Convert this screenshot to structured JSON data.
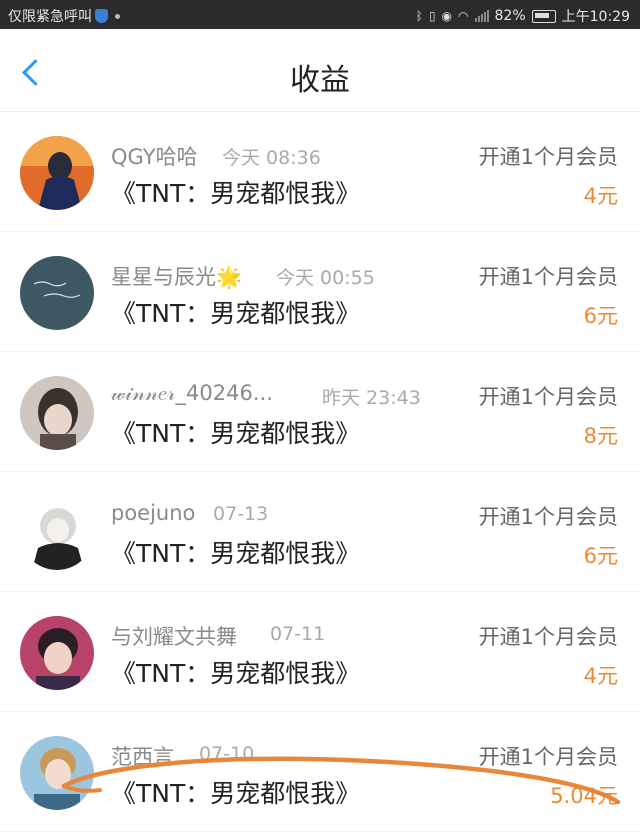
{
  "status_bar": {
    "carrier_text": "仅限紧急呼叫",
    "battery_percent": "82%",
    "time": "上午10:29"
  },
  "header": {
    "title": "收益",
    "back_icon": "chevron-left-icon",
    "accent_color": "#2b9bef"
  },
  "earnings": [
    {
      "name": "QGY哈哈",
      "time": "今天 08:36",
      "action": "开通1个月会员",
      "book": "《TNT：男宠都恨我》",
      "amount": "4元"
    },
    {
      "name": "星星与辰光🌟",
      "time": "今天 00:55",
      "action": "开通1个月会员",
      "book": "《TNT：男宠都恨我》",
      "amount": "6元"
    },
    {
      "name": "𝓌𝒾𝓃𝓃𝑒𝓇_40246...",
      "time": "昨天 23:43",
      "action": "开通1个月会员",
      "book": "《TNT：男宠都恨我》",
      "amount": "8元"
    },
    {
      "name": "poejuno",
      "time": "07-13",
      "action": "开通1个月会员",
      "book": "《TNT：男宠都恨我》",
      "amount": "6元"
    },
    {
      "name": "与刘耀文共舞",
      "time": "07-11",
      "action": "开通1个月会员",
      "book": "《TNT：男宠都恨我》",
      "amount": "4元"
    },
    {
      "name": "范西言",
      "time": "07-10",
      "action": "开通1个月会员",
      "book": "《TNT：男宠都恨我》",
      "amount": "5.04元"
    }
  ],
  "colors": {
    "amount": "#ee8a2e",
    "annotation_stroke": "#e8873a"
  }
}
